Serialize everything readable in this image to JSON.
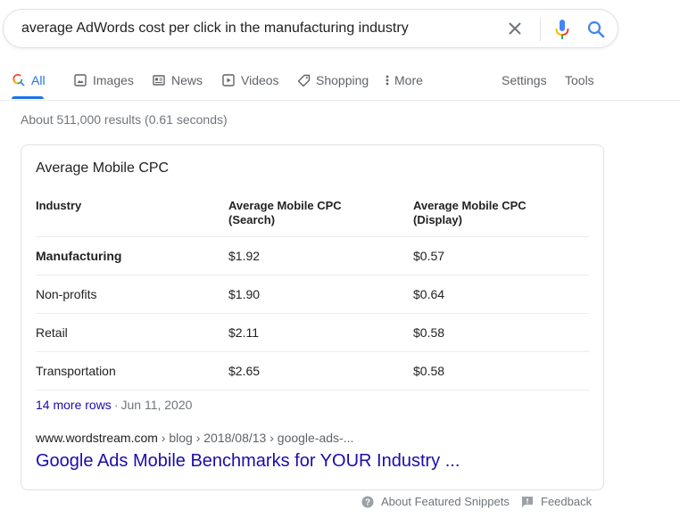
{
  "search": {
    "query": "average AdWords cost per click in the manufacturing industry",
    "icons": {
      "clear": "close-icon",
      "voice": "microphone-icon",
      "submit": "search-icon"
    }
  },
  "tabs": [
    {
      "label": "All",
      "icon": "search-icon",
      "active": true
    },
    {
      "label": "Images",
      "icon": "image-icon",
      "active": false
    },
    {
      "label": "News",
      "icon": "newspaper-icon",
      "active": false
    },
    {
      "label": "Videos",
      "icon": "play-icon",
      "active": false
    },
    {
      "label": "Shopping",
      "icon": "tag-icon",
      "active": false
    },
    {
      "label": "More",
      "icon": "more-vertical-icon",
      "active": false
    }
  ],
  "tools": {
    "settings": "Settings",
    "tools": "Tools"
  },
  "result_stats": "About 511,000 results (0.61 seconds)",
  "snippet": {
    "title": "Average Mobile CPC",
    "table": {
      "headers": [
        "Industry",
        "Average Mobile CPC (Search)",
        "Average Mobile CPC (Display)"
      ],
      "header_lines": [
        [
          "Industry"
        ],
        [
          "Average Mobile CPC",
          "(Search)"
        ],
        [
          "Average Mobile CPC",
          "(Display)"
        ]
      ],
      "rows": [
        {
          "industry": "Manufacturing",
          "search": "$1.92",
          "display": "$0.57",
          "highlighted": true
        },
        {
          "industry": "Non-profits",
          "search": "$1.90",
          "display": "$0.64",
          "highlighted": false
        },
        {
          "industry": "Retail",
          "search": "$2.11",
          "display": "$0.58",
          "highlighted": false
        },
        {
          "industry": "Transportation",
          "search": "$2.65",
          "display": "$0.58",
          "highlighted": false
        }
      ]
    },
    "more_rows": "14 more rows",
    "separator": "·",
    "date": "Jun 11, 2020",
    "cite": {
      "domain": "www.wordstream.com",
      "path": " › blog › 2018/08/13 › google-ads-..."
    },
    "link_title": "Google Ads Mobile Benchmarks for YOUR Industry ..."
  },
  "footer": {
    "about": "About Featured Snippets",
    "feedback": "Feedback"
  },
  "colors": {
    "accent_blue": "#1a73e8",
    "link": "#1a0dab",
    "muted": "#70757a"
  }
}
